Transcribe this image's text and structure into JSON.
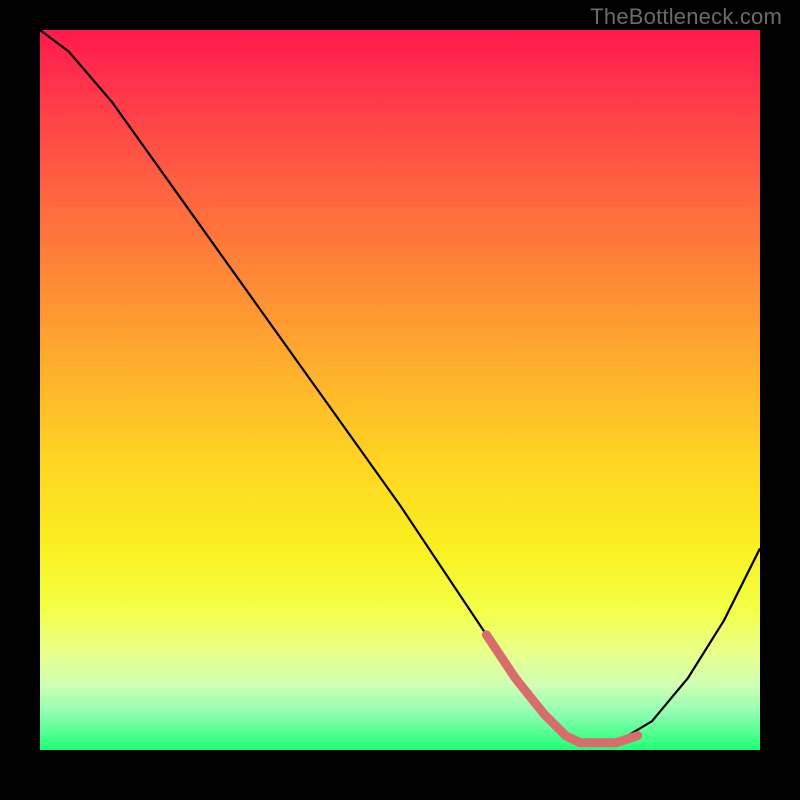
{
  "watermark": "TheBottleneck.com",
  "chart_data": {
    "type": "line",
    "title": "",
    "xlabel": "",
    "ylabel": "",
    "xlim": [
      0,
      100
    ],
    "ylim": [
      0,
      100
    ],
    "grid": false,
    "series": [
      {
        "name": "main-curve",
        "color": "#000000",
        "x": [
          0,
          4,
          10,
          20,
          30,
          40,
          50,
          58,
          62,
          66,
          70,
          73,
          75,
          80,
          85,
          90,
          95,
          100
        ],
        "y": [
          100,
          97,
          90,
          76,
          62,
          48,
          34,
          22,
          16,
          10,
          5,
          2,
          1,
          1,
          4,
          10,
          18,
          28
        ]
      },
      {
        "name": "highlight-segment",
        "color": "#d96c6c",
        "x": [
          62,
          66,
          70,
          73,
          75,
          80,
          83
        ],
        "y": [
          16,
          10,
          5,
          2,
          1,
          1,
          2
        ]
      }
    ],
    "background_gradient": {
      "top": "#ff1a4d",
      "mid_upper": "#ff8a36",
      "mid": "#ffd522",
      "mid_lower": "#f4ff43",
      "bottom": "#1fff75"
    }
  }
}
